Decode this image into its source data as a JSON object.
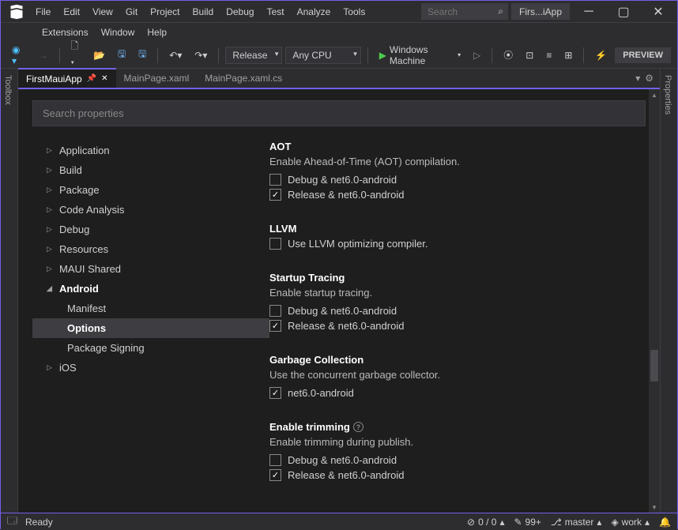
{
  "titlebar": {
    "menus": [
      "File",
      "Edit",
      "View",
      "Git",
      "Project",
      "Build",
      "Debug",
      "Test",
      "Analyze",
      "Tools"
    ],
    "menus2": [
      "Extensions",
      "Window",
      "Help"
    ],
    "search_placeholder": "Search",
    "solution": "Firs...iApp"
  },
  "toolbar": {
    "config": "Release",
    "platform": "Any CPU",
    "target": "Windows Machine",
    "preview": "PREVIEW"
  },
  "sidetabs": {
    "left": "Toolbox",
    "right": "Properties"
  },
  "doctabs": {
    "tabs": [
      {
        "label": "FirstMauiApp",
        "active": true,
        "pinned": true
      },
      {
        "label": "MainPage.xaml",
        "active": false
      },
      {
        "label": "MainPage.xaml.cs",
        "active": false
      }
    ]
  },
  "search_props": "Search properties",
  "tree": {
    "items": [
      {
        "label": "Application",
        "kind": "collapsed"
      },
      {
        "label": "Build",
        "kind": "collapsed"
      },
      {
        "label": "Package",
        "kind": "collapsed"
      },
      {
        "label": "Code Analysis",
        "kind": "collapsed"
      },
      {
        "label": "Debug",
        "kind": "collapsed"
      },
      {
        "label": "Resources",
        "kind": "collapsed"
      },
      {
        "label": "MAUI Shared",
        "kind": "collapsed"
      },
      {
        "label": "Android",
        "kind": "expanded"
      },
      {
        "label": "Manifest",
        "kind": "sub"
      },
      {
        "label": "Options",
        "kind": "sub-selected"
      },
      {
        "label": "Package Signing",
        "kind": "sub"
      },
      {
        "label": "iOS",
        "kind": "collapsed"
      }
    ]
  },
  "settings": [
    {
      "title": "AOT",
      "desc": "Enable Ahead-of-Time (AOT) compilation.",
      "checks": [
        {
          "label": "Debug & net6.0-android",
          "checked": false
        },
        {
          "label": "Release & net6.0-android",
          "checked": true
        }
      ]
    },
    {
      "title": "LLVM",
      "desc": "",
      "checks": [
        {
          "label": "Use LLVM optimizing compiler.",
          "checked": false
        }
      ]
    },
    {
      "title": "Startup Tracing",
      "desc": "Enable startup tracing.",
      "checks": [
        {
          "label": "Debug & net6.0-android",
          "checked": false
        },
        {
          "label": "Release & net6.0-android",
          "checked": true
        }
      ]
    },
    {
      "title": "Garbage Collection",
      "desc": "Use the concurrent garbage collector.",
      "checks": [
        {
          "label": "net6.0-android",
          "checked": true
        }
      ]
    },
    {
      "title": "Enable trimming",
      "help": true,
      "desc": "Enable trimming during publish.",
      "checks": [
        {
          "label": "Debug & net6.0-android",
          "checked": false
        },
        {
          "label": "Release & net6.0-android",
          "checked": true
        }
      ]
    }
  ],
  "statusbar": {
    "ready": "Ready",
    "errors": "0 / 0",
    "changes": "99+",
    "branch": "master",
    "repo": "work"
  }
}
